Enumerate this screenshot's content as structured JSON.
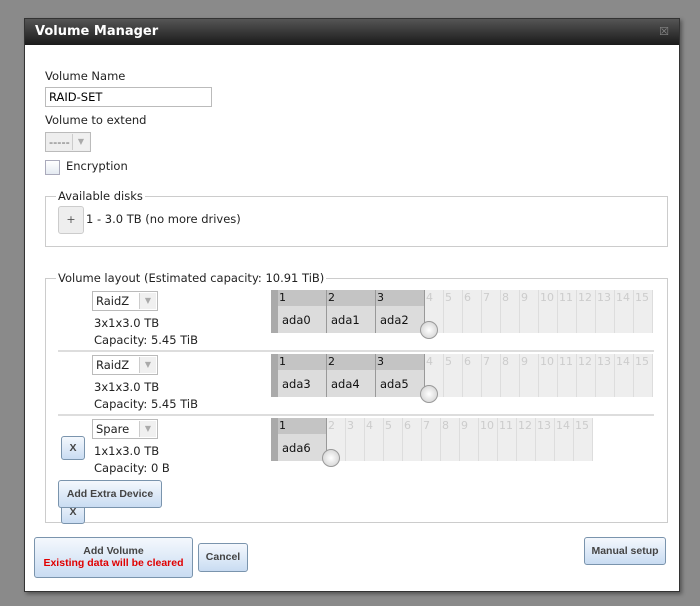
{
  "dialog": {
    "title": "Volume Manager",
    "close_icon": "close-icon"
  },
  "form": {
    "volume_name_label": "Volume Name",
    "volume_name_value": "RAID-SET",
    "extend_label": "Volume to extend",
    "extend_value": "-----",
    "encryption_label": "Encryption",
    "encryption_checked": false
  },
  "available": {
    "legend": "Available disks",
    "add_label": "+",
    "text": "1 - 3.0 TB (no more drives)"
  },
  "layout": {
    "legend": "Volume layout (Estimated capacity: 10.91 TiB)",
    "rows": [
      {
        "type": "RaidZ",
        "desc": "3x1x3.0 TB",
        "capacity": "Capacity: 5.45 TiB",
        "removable": false,
        "disks": [
          "ada0",
          "ada1",
          "ada2"
        ],
        "columns": 15
      },
      {
        "type": "RaidZ",
        "desc": "3x1x3.0 TB",
        "capacity": "Capacity: 5.45 TiB",
        "removable": true,
        "disks": [
          "ada3",
          "ada4",
          "ada5"
        ],
        "columns": 15
      },
      {
        "type": "Spare",
        "desc": "1x1x3.0 TB",
        "capacity": "Capacity: 0 B",
        "removable": true,
        "disks": [
          "ada6"
        ],
        "columns": 15
      }
    ],
    "remove_label": "X",
    "add_extra_label": "Add Extra Device"
  },
  "footer": {
    "add_volume_label": "Add Volume",
    "add_volume_warning": "Existing data will be cleared",
    "warning_color": "#e00000",
    "cancel_label": "Cancel",
    "manual_label": "Manual setup"
  }
}
